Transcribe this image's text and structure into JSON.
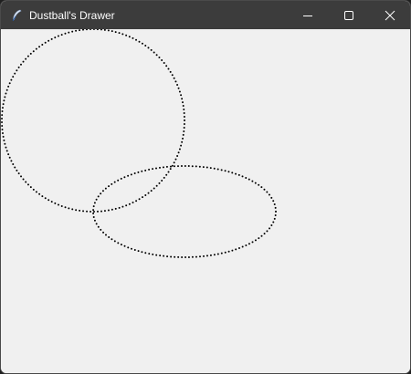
{
  "window": {
    "title": "Dustball's Drawer",
    "icon": "feather-icon",
    "controls": [
      "minimize-icon",
      "maximize-icon",
      "close-icon"
    ]
  },
  "canvas": {
    "background": "#f0f0f0",
    "shape_style": "dotted",
    "shape_color": "#000000",
    "shapes": [
      "circle",
      "ellipse"
    ]
  },
  "colors": {
    "titlebar": "#3c3c3c",
    "title_text": "#ffffff"
  }
}
